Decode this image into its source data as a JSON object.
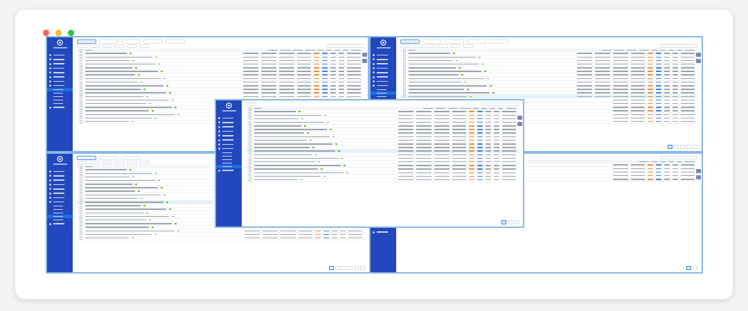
{
  "windows": [
    {
      "tabs": [
        {
          "selected": true
        },
        {
          "selected": false
        },
        {
          "selected": false
        },
        {
          "selected": false
        },
        {
          "selected": false
        }
      ],
      "sidebar": {
        "items": [
          {
            "kind": "group",
            "selected": false
          },
          {
            "kind": "group",
            "selected": false
          },
          {
            "kind": "group",
            "selected": false
          },
          {
            "kind": "group",
            "selected": false
          },
          {
            "kind": "group",
            "selected": false
          },
          {
            "kind": "group",
            "selected": false
          },
          {
            "kind": "group",
            "selected": false
          },
          {
            "kind": "group",
            "selected": false
          },
          {
            "kind": "sub",
            "selected": true
          },
          {
            "kind": "sub",
            "selected": false
          },
          {
            "kind": "sub",
            "selected": false
          },
          {
            "kind": "sub",
            "selected": false
          },
          {
            "kind": "sub",
            "selected": false
          },
          {
            "kind": "group",
            "selected": false
          }
        ]
      },
      "rows": [
        {
          "selected": false
        },
        {
          "selected": false
        },
        {
          "selected": false
        },
        {
          "selected": false
        },
        {
          "selected": false
        },
        {
          "selected": false
        },
        {
          "selected": false
        },
        {
          "selected": false
        },
        {
          "selected": false
        },
        {
          "selected": false
        },
        {
          "selected": false
        },
        {
          "selected": false
        },
        {
          "selected": false
        },
        {
          "selected": false
        },
        {
          "selected": false
        },
        {
          "selected": false
        },
        {
          "selected": false
        },
        {
          "selected": false
        },
        {
          "selected": false
        },
        {
          "selected": false
        }
      ]
    },
    {
      "tabs": [
        {
          "selected": true
        },
        {
          "selected": false
        },
        {
          "selected": false
        },
        {
          "selected": false
        },
        {
          "selected": false
        }
      ],
      "sidebar": {
        "items": [
          {
            "kind": "group",
            "selected": false
          },
          {
            "kind": "group",
            "selected": false
          },
          {
            "kind": "group",
            "selected": false
          },
          {
            "kind": "group",
            "selected": false
          },
          {
            "kind": "group",
            "selected": false
          },
          {
            "kind": "group",
            "selected": false
          },
          {
            "kind": "group",
            "selected": false
          },
          {
            "kind": "group",
            "selected": false
          },
          {
            "kind": "sub",
            "selected": false
          },
          {
            "kind": "sub",
            "selected": true
          },
          {
            "kind": "sub",
            "selected": false
          }
        ]
      },
      "rows": [
        {
          "selected": false
        },
        {
          "selected": false
        },
        {
          "selected": false
        },
        {
          "selected": false
        },
        {
          "selected": false
        },
        {
          "selected": false
        },
        {
          "selected": false
        },
        {
          "selected": false
        },
        {
          "selected": false
        },
        {
          "selected": false
        },
        {
          "selected": false
        },
        {
          "selected": false
        },
        {
          "selected": true
        },
        {
          "selected": false
        },
        {
          "selected": false
        },
        {
          "selected": false
        },
        {
          "selected": false
        },
        {
          "selected": false
        },
        {
          "selected": false
        },
        {
          "selected": false
        }
      ],
      "pages": [
        {
          "selected": true
        },
        {
          "selected": false
        },
        {
          "selected": false
        },
        {
          "selected": false
        },
        {
          "selected": false
        }
      ]
    },
    {
      "tabs": [
        {
          "selected": true
        },
        {
          "selected": false
        },
        {
          "selected": false
        }
      ],
      "sidebar": {
        "items": [
          {
            "kind": "group",
            "selected": false
          },
          {
            "kind": "group",
            "selected": false
          },
          {
            "kind": "group",
            "selected": false
          },
          {
            "kind": "group",
            "selected": false
          },
          {
            "kind": "group",
            "selected": false
          },
          {
            "kind": "group",
            "selected": false
          },
          {
            "kind": "group",
            "selected": false
          },
          {
            "kind": "group",
            "selected": false
          },
          {
            "kind": "sub",
            "selected": false
          },
          {
            "kind": "sub",
            "selected": false
          },
          {
            "kind": "sub",
            "selected": false
          },
          {
            "kind": "sub",
            "selected": true
          },
          {
            "kind": "sub",
            "selected": false
          },
          {
            "kind": "group",
            "selected": false
          }
        ]
      },
      "rows": [
        {
          "selected": false
        },
        {
          "selected": false
        },
        {
          "selected": false
        },
        {
          "selected": false
        },
        {
          "selected": false
        },
        {
          "selected": false
        },
        {
          "selected": false
        },
        {
          "selected": false
        },
        {
          "selected": false
        },
        {
          "selected": true
        },
        {
          "selected": false
        },
        {
          "selected": false
        },
        {
          "selected": false
        },
        {
          "selected": false
        },
        {
          "selected": false
        },
        {
          "selected": false
        },
        {
          "selected": false
        },
        {
          "selected": false
        },
        {
          "selected": false
        },
        {
          "selected": false
        }
      ],
      "pages": [
        {
          "selected": true
        },
        {
          "selected": false
        },
        {
          "selected": false
        },
        {
          "selected": false
        },
        {
          "selected": false
        },
        {
          "selected": false
        }
      ]
    },
    {
      "sidebar": {
        "items": [
          {
            "kind": "group",
            "selected": false
          }
        ]
      },
      "rows": [
        {
          "selected": false
        },
        {
          "selected": false
        },
        {
          "selected": false
        },
        {
          "selected": false
        },
        {
          "selected": false
        }
      ],
      "pages": [
        {
          "selected": true
        },
        {
          "selected": false
        }
      ]
    },
    {
      "sidebar": {
        "items": [
          {
            "kind": "group",
            "selected": false
          },
          {
            "kind": "group",
            "selected": false
          },
          {
            "kind": "group",
            "selected": false
          },
          {
            "kind": "group",
            "selected": false
          },
          {
            "kind": "group",
            "selected": false
          },
          {
            "kind": "group",
            "selected": false
          },
          {
            "kind": "group",
            "selected": false
          },
          {
            "kind": "group",
            "selected": false
          },
          {
            "kind": "sub",
            "selected": false
          },
          {
            "kind": "sub",
            "selected": false
          },
          {
            "kind": "sub",
            "selected": false
          },
          {
            "kind": "sub",
            "selected": false
          },
          {
            "kind": "sub",
            "selected": true
          },
          {
            "kind": "group",
            "selected": false
          }
        ]
      },
      "rows": [
        {
          "selected": false
        },
        {
          "selected": false
        },
        {
          "selected": false
        },
        {
          "selected": false
        },
        {
          "selected": false
        },
        {
          "selected": false
        },
        {
          "selected": false
        },
        {
          "selected": false
        },
        {
          "selected": false
        },
        {
          "selected": false
        },
        {
          "selected": false
        },
        {
          "selected": true
        },
        {
          "selected": false
        },
        {
          "selected": false
        },
        {
          "selected": false
        },
        {
          "selected": false
        },
        {
          "selected": false
        },
        {
          "selected": false
        },
        {
          "selected": false
        },
        {
          "selected": false
        }
      ],
      "pages": [
        {
          "selected": true
        },
        {
          "selected": false
        },
        {
          "selected": false
        }
      ]
    }
  ]
}
